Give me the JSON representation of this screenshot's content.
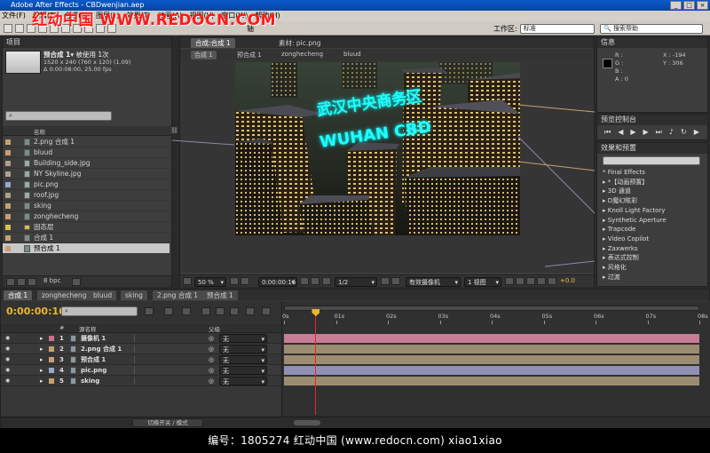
{
  "window": {
    "title": "Adobe After Effects - CBDwenjian.aep",
    "buttons": [
      "_",
      "□",
      "×"
    ]
  },
  "menu": [
    "文件(F)",
    "编辑(E)",
    "合成(C)",
    "图层(L)",
    "效果(T)",
    "动画(A)",
    "视图(V)",
    "窗口(W)",
    "帮助(H)"
  ],
  "watermark_top": "红动中国 WWW.REDOCN.COM",
  "toolbar": {
    "workspace_label": "工作区:",
    "workspace_value": "标准",
    "search_placeholder": "搜索帮助",
    "axis_label": "轴"
  },
  "project": {
    "panel_title": "项目",
    "selected_name": "预合成 1▾",
    "used_text": "被使用 1次",
    "info_line1": "1520 x 240  (760 x 120) (1.09)",
    "info_line2": "Δ 0:00:08:00, 25.00 fps",
    "col_name": "名称",
    "bpc": "8 bpc",
    "items": [
      {
        "name": "2.png 合成 1",
        "color": "#c8a070",
        "icon": "comp"
      },
      {
        "name": "bluud",
        "color": "#c8a070",
        "icon": "comp"
      },
      {
        "name": "Building_side.jpg",
        "color": "#b0a088",
        "icon": "image"
      },
      {
        "name": "NY Skyline.jpg",
        "color": "#b0a088",
        "icon": "image"
      },
      {
        "name": "pic.png",
        "color": "#9ca7c8",
        "icon": "image"
      },
      {
        "name": "roof.jpg",
        "color": "#b0a088",
        "icon": "image"
      },
      {
        "name": "sking",
        "color": "#c8a070",
        "icon": "comp"
      },
      {
        "name": "zonghecheng",
        "color": "#c8a070",
        "icon": "comp"
      },
      {
        "name": "固态层",
        "color": "#d8c050",
        "icon": "folder"
      },
      {
        "name": "合成 1",
        "color": "#c8a070",
        "icon": "comp"
      },
      {
        "name": "预合成 1",
        "color": "#c8a070",
        "icon": "comp",
        "selected": true
      }
    ]
  },
  "comp": {
    "tab_comp": "合成:合成 1",
    "tab_footage": "素材: pic.png",
    "crumbs": [
      "合成 1",
      "预合成 1",
      "zonghecheng",
      "bluud"
    ],
    "sign_cn": "武汉中央商务区",
    "sign_en": "WUHAN CBD",
    "zoom": "50 %",
    "timecode": "0:00:00:16",
    "resolution": "1/2",
    "camera": "有效摄像机",
    "view": "1 视图",
    "exposure": "+0.0"
  },
  "info": {
    "title": "信息",
    "r": "R :",
    "g": "G :",
    "b": "B :",
    "a": "A : 0",
    "x": "X : -194",
    "y": "Y : 306"
  },
  "preview": {
    "title": "预览控制台"
  },
  "effects": {
    "title": "效果和预置",
    "items": [
      "* Final Effects",
      "▸ *【动画预置】",
      "▸ 3D 通道",
      "▸ D魔幻眩彩",
      "▸ Knoll Light Factory",
      "▸ Synthetic Aperture",
      "▸ Trapcode",
      "▸ Video Copilot",
      "▸ Zaxwerks",
      "▸ 表达式控制",
      "▸ 风格化",
      "▸ 过渡"
    ]
  },
  "timeline": {
    "tabs": [
      "合成 1",
      "zonghecheng",
      "bluud",
      "sking",
      "2.png 合成 1",
      "预合成 1"
    ],
    "timecode": "0:00:00:16",
    "col_num": "#",
    "col_name": "源名称",
    "col_parent": "父级",
    "ruler": [
      "0s",
      "01s",
      "02s",
      "03s",
      "04s",
      "05s",
      "06s",
      "07s",
      "08s"
    ],
    "playhead_seconds": 0.64,
    "layers": [
      {
        "num": "1",
        "name": "摄像机 1",
        "parent": "无",
        "color": "#d07090",
        "bar": "#c87d96"
      },
      {
        "num": "2",
        "name": "2.png 合成 1",
        "parent": "无",
        "color": "#c8a070",
        "bar": "#9c8c72"
      },
      {
        "num": "3",
        "name": "预合成 1",
        "parent": "无",
        "color": "#c8a070",
        "bar": "#9c8c72"
      },
      {
        "num": "4",
        "name": "pic.png",
        "parent": "无",
        "color": "#9ca7c8",
        "bar": "#8f90b4"
      },
      {
        "num": "5",
        "name": "sking",
        "parent": "无",
        "color": "#c8a070",
        "bar": "#9c8c72"
      }
    ],
    "toggle_label": "切换开关 / 模式"
  },
  "footer": {
    "text": "编号：1805274    红动中国 (www.redocn.com)    xiao1xiao"
  }
}
